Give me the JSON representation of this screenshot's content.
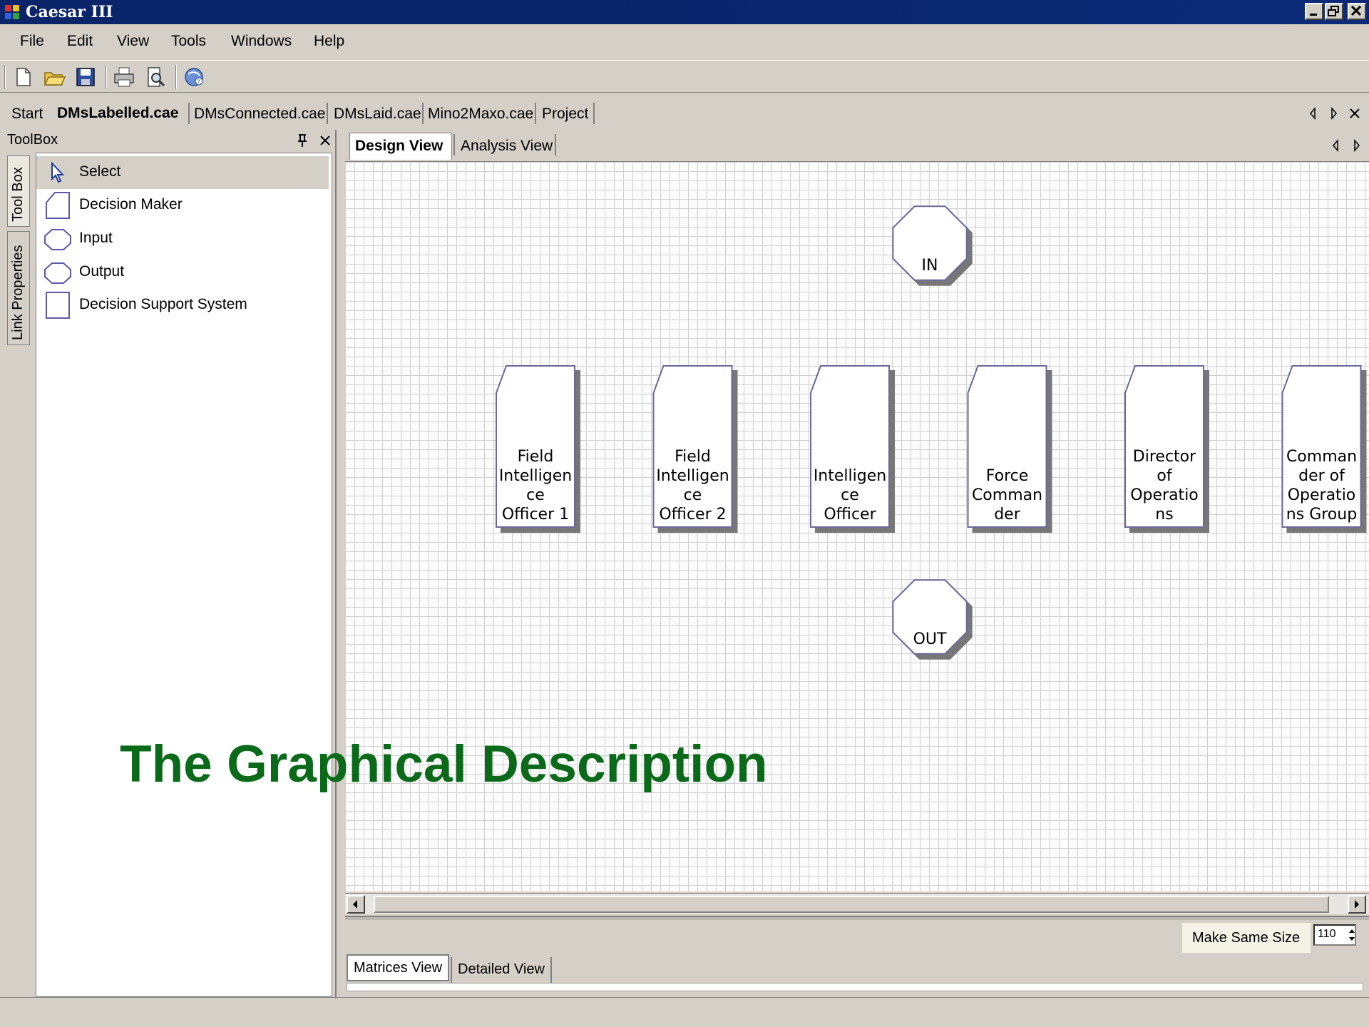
{
  "window": {
    "title": "Caesar III"
  },
  "menu": [
    "File",
    "Edit",
    "View",
    "Tools",
    "Windows",
    "Help"
  ],
  "toolbar": {
    "buttons": [
      "new-icon",
      "open-icon",
      "save-icon",
      "print-icon",
      "print-preview-icon",
      "help-icon"
    ]
  },
  "doc_tabs": {
    "items": [
      "Start",
      "DMsLabelled.cae",
      "DMsConnected.cae",
      "DMsLaid.cae",
      "Mino2Maxo.cae",
      "Project"
    ],
    "active": "DMsLabelled.cae"
  },
  "toolbox": {
    "title": "ToolBox",
    "side_tabs": [
      "Tool Box",
      "Link Properties"
    ],
    "items": [
      {
        "label": "Select",
        "icon": "cursor-icon"
      },
      {
        "label": "Decision Maker",
        "icon": "decision-maker-shape-icon"
      },
      {
        "label": "Input",
        "icon": "input-octagon-icon"
      },
      {
        "label": "Output",
        "icon": "output-octagon-icon"
      },
      {
        "label": "Decision Support System",
        "icon": "dss-square-icon"
      }
    ]
  },
  "view_tabs": {
    "items": [
      "Design View",
      "Analysis View"
    ],
    "active": "Design View"
  },
  "diagram": {
    "input_node": "IN",
    "output_node": "OUT",
    "decision_makers": [
      [
        "Field",
        "Intelligen",
        "ce",
        "Officer 1"
      ],
      [
        "Field",
        "Intelligen",
        "ce",
        "Officer 2"
      ],
      [
        "Intelligen",
        "ce",
        "Officer"
      ],
      [
        "Force",
        "Comman",
        "der"
      ],
      [
        "Director",
        "of",
        "Operatio",
        "ns"
      ],
      [
        "Comman",
        "der of",
        "Operatio",
        "ns Group"
      ]
    ]
  },
  "bottom": {
    "make_same_size": "Make Same Size",
    "size_value": "110",
    "tabs": [
      "Matrices View",
      "Detailed View"
    ],
    "active": "Matrices View"
  },
  "caption": "The Graphical Description",
  "colors": {
    "titlebar": "#0a246a",
    "caption": "#0a6a1a",
    "chrome": "#d4d0c8",
    "node_stroke": "#6a6a9a"
  }
}
